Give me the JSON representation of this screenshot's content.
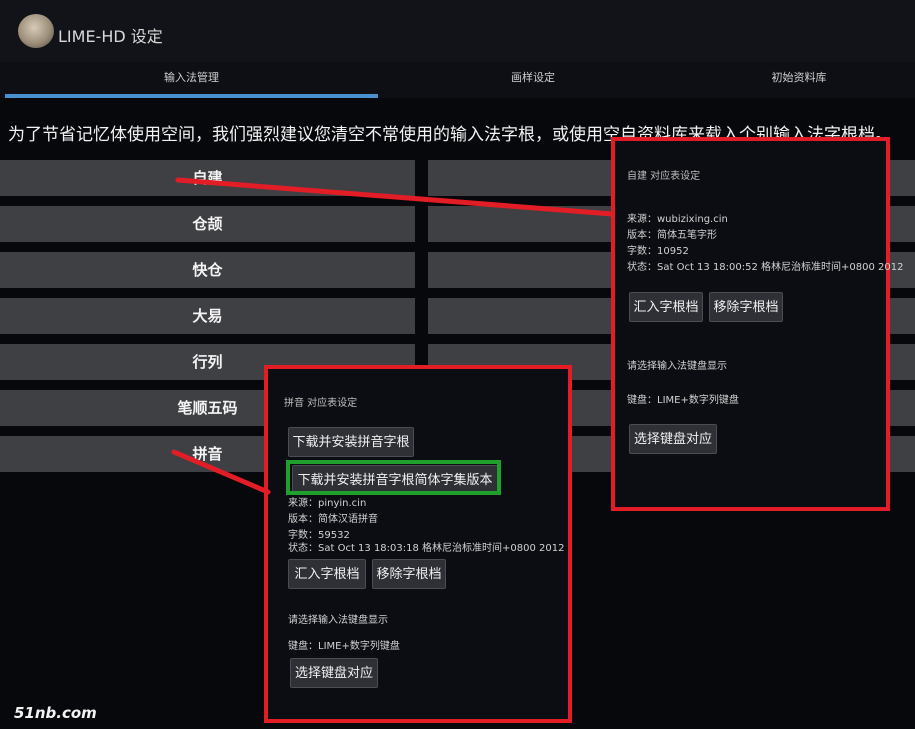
{
  "header": {
    "title": "LIME-HD 设定"
  },
  "tabs": [
    {
      "label": "输入法管理"
    },
    {
      "label": "画样设定"
    },
    {
      "label": "初始资料库"
    }
  ],
  "notice": "为了节省记忆体使用空间，我们强烈建议您清空不常使用的输入法字根，或使用空自资料库来载入个别输入法字根档。",
  "im_list": [
    {
      "label": "自建"
    },
    {
      "label": "仓颉"
    },
    {
      "label": "快仓"
    },
    {
      "label": "大易"
    },
    {
      "label": "行列"
    },
    {
      "label": "笔顺五码"
    },
    {
      "label": "拼音"
    }
  ],
  "custom_dialog": {
    "title": "自建 对应表设定",
    "source": "来源：wubizixing.cin",
    "version": "版本：简体五笔字形",
    "count": "字数：10952",
    "status": "状态：Sat Oct 13 18:00:52 格林尼治标准时间+0800 2012",
    "import_label": "汇入字根档",
    "remove_label": "移除字根档",
    "keyboard_prompt": "请选择输入法键盘显示",
    "keyboard_value": "键盘：LIME+数字列键盘",
    "select_keyboard_label": "选择键盘对应"
  },
  "pinyin_dialog": {
    "title": "拼音 对应表设定",
    "download_label": "下载并安装拼音字根",
    "download_simplified_label": "下载并安装拼音字根简体字集版本",
    "source": "来源：pinyin.cin",
    "version": "版本：简体汉语拼音",
    "count": "字数：59532",
    "status": "状态：Sat Oct 13 18:03:18 格林尼治标准时间+0800 2012",
    "import_label": "汇入字根档",
    "remove_label": "移除字根档",
    "keyboard_prompt": "请选择输入法键盘显示",
    "keyboard_value": "键盘：LIME+数字列键盘",
    "select_keyboard_label": "选择键盘对应"
  },
  "watermark": "51nb.com",
  "colors": {
    "highlight_red": "#e21d25",
    "highlight_green": "#1fa02d",
    "tab_indicator": "#4a8fd0"
  }
}
